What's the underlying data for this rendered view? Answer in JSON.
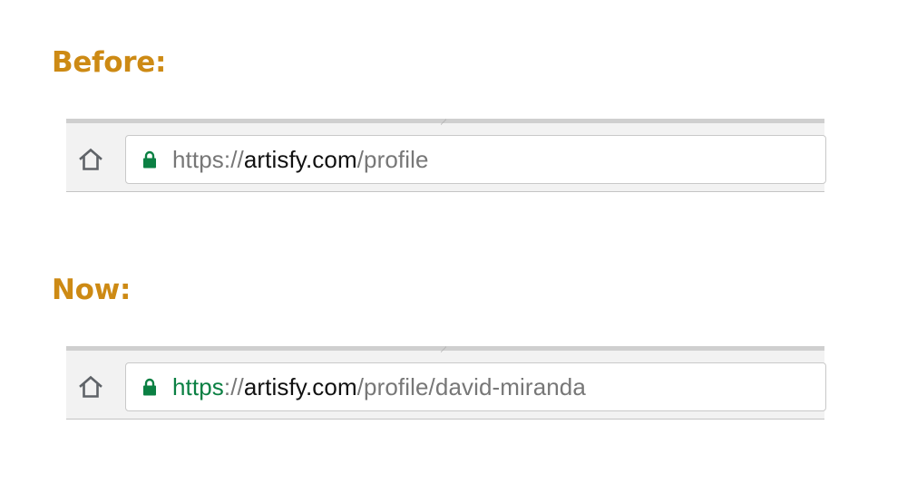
{
  "colors": {
    "heading": "#cd8a14",
    "secure_green": "#0b8043",
    "url_gray": "#777777",
    "host_black": "#111111",
    "toolbar_bg": "#f2f2f2"
  },
  "before": {
    "heading": "Before:",
    "url": {
      "scheme": "https",
      "separator": "://",
      "host": "artisfy.com",
      "path": "/profile"
    },
    "icons": [
      "home-icon",
      "lock-icon"
    ]
  },
  "now": {
    "heading": "Now:",
    "url": {
      "scheme": "https",
      "separator": "://",
      "host": "artisfy.com",
      "path": "/profile/david-miranda"
    },
    "icons": [
      "home-icon",
      "lock-icon"
    ]
  }
}
